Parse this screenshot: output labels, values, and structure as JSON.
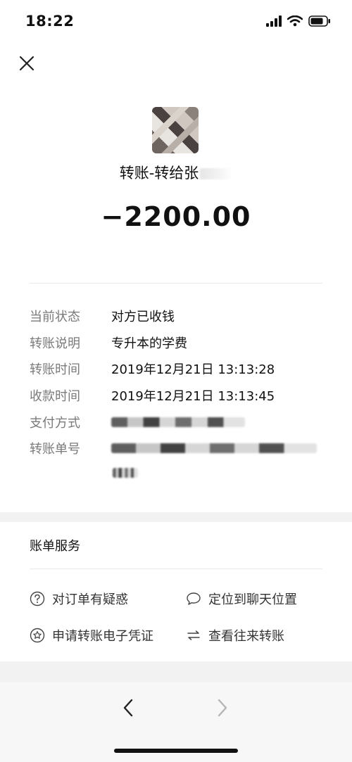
{
  "status_bar": {
    "time": "18:22"
  },
  "header": {
    "title": "转账-转给张",
    "amount": "−2200.00"
  },
  "details": [
    {
      "label": "当前状态",
      "value": "对方已收钱"
    },
    {
      "label": "转账说明",
      "value": "专升本的学费"
    },
    {
      "label": "转账时间",
      "value": "2019年12月21日 13:13:28"
    },
    {
      "label": "收款时间",
      "value": "2019年12月21日 13:13:45"
    },
    {
      "label": "支付方式",
      "value": ""
    },
    {
      "label": "转账单号",
      "value": ""
    }
  ],
  "services": {
    "title": "账单服务",
    "items": [
      {
        "label": "对订单有疑惑",
        "icon": "question-circle-icon"
      },
      {
        "label": "定位到聊天位置",
        "icon": "chat-bubble-icon"
      },
      {
        "label": "申请转账电子凭证",
        "icon": "star-circle-icon"
      },
      {
        "label": "查看往来转账",
        "icon": "swap-arrows-icon"
      }
    ]
  },
  "colors": {
    "label_gray": "#7a7a7a",
    "text": "#111111",
    "background": "#f2f2f2"
  }
}
